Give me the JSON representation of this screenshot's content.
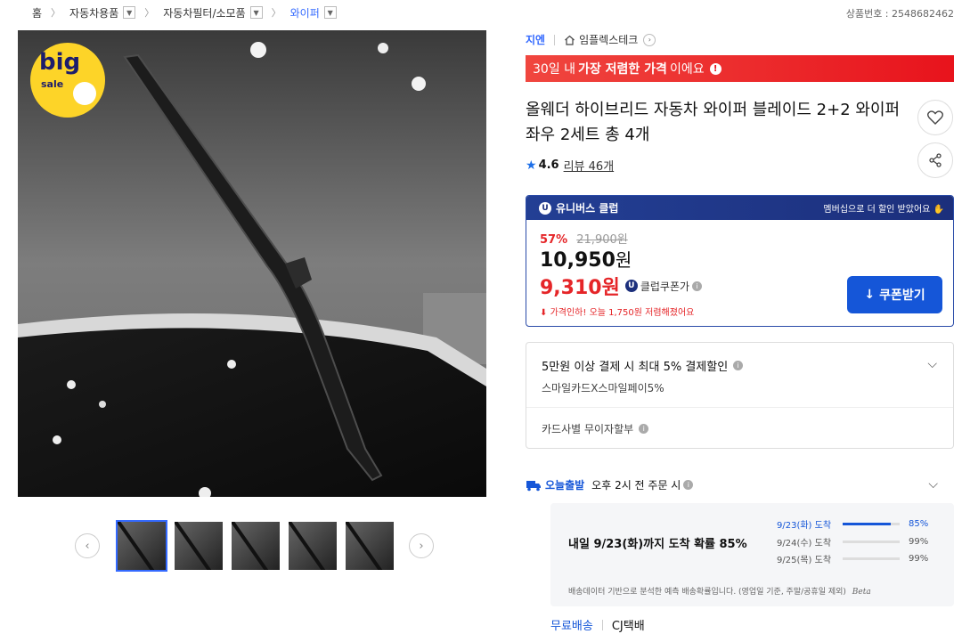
{
  "breadcrumb": {
    "home": "홈",
    "items": [
      "자동차용품",
      "자동차필터/소모품",
      "와이퍼"
    ]
  },
  "product_no": "상품번호 : 2548682462",
  "badge": {
    "big": "big",
    "sale": "sale"
  },
  "brand": "지엔",
  "store": "임플렉스테크",
  "lowest_banner": {
    "pre": "30일 내",
    "bold": "가장 저렴한 가격",
    "post": "이에요"
  },
  "title": "올웨더 하이브리드 자동차 와이퍼 블레이드 2+2 와이퍼 좌우 2세트 총 4개",
  "rating": {
    "score": "4.6",
    "reviews": "리뷰 46개"
  },
  "club": {
    "name": "유니버스 클럽",
    "promo": "멤버십으로 더 할인 받았어요",
    "discount_pct": "57%",
    "original_price": "21,900원",
    "price_num": "10,950",
    "price_unit": "원",
    "club_price": "9,310원",
    "club_label": "클럽쿠폰가",
    "price_cut": "가격인하! 오늘 1,750원 저렴해졌어요",
    "coupon_button": "쿠폰받기"
  },
  "card": {
    "line1": "5만원 이상 결제 시 최대 5% 결제할인",
    "line2": "스마일카드X스마일페이5%",
    "line3": "카드사별 무이자할부"
  },
  "delivery": {
    "label": "오늘출발",
    "cond": "오후 2시 전 주문 시",
    "headline": "내일 9/23(화)까지 도착 확률 85%",
    "rows": [
      {
        "date": "9/23(화) 도착",
        "pct": "85%",
        "value": 0.85
      },
      {
        "date": "9/24(수) 도착",
        "pct": "99%",
        "value": 0.99
      },
      {
        "date": "9/25(목) 도착",
        "pct": "99%",
        "value": 0.99
      }
    ],
    "note": "배송데이터 기반으로 분석한 예측 배송확률입니다. (영업일 기준, 주말/공휴일 제외)",
    "beta": "Beta",
    "free": "무료배송",
    "courier": "CJ택배"
  },
  "colors": {
    "accent": "#346aff",
    "red": "#e52528",
    "club_navy": "#1c2f7c"
  }
}
